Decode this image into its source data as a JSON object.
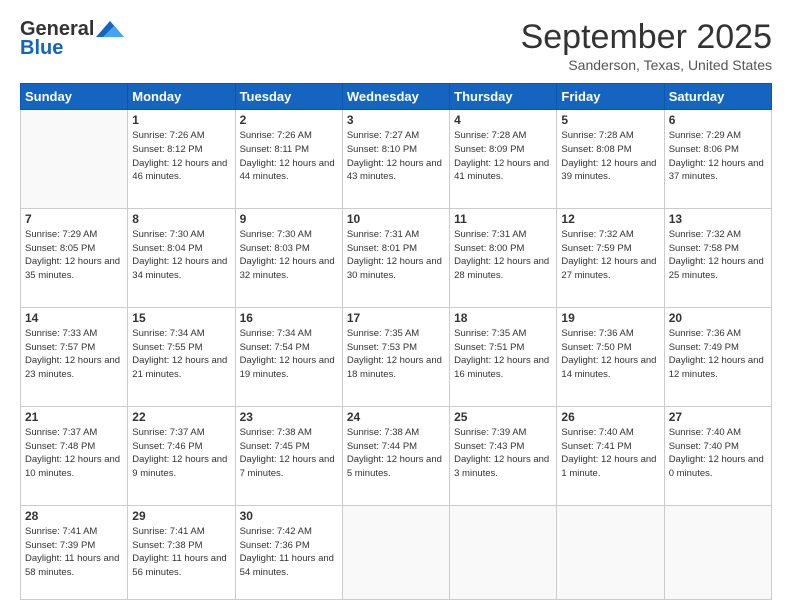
{
  "header": {
    "logo_general": "General",
    "logo_blue": "Blue",
    "month": "September 2025",
    "location": "Sanderson, Texas, United States"
  },
  "days_of_week": [
    "Sunday",
    "Monday",
    "Tuesday",
    "Wednesday",
    "Thursday",
    "Friday",
    "Saturday"
  ],
  "weeks": [
    [
      {
        "day": "",
        "info": ""
      },
      {
        "day": "1",
        "info": "Sunrise: 7:26 AM\nSunset: 8:12 PM\nDaylight: 12 hours\nand 46 minutes."
      },
      {
        "day": "2",
        "info": "Sunrise: 7:26 AM\nSunset: 8:11 PM\nDaylight: 12 hours\nand 44 minutes."
      },
      {
        "day": "3",
        "info": "Sunrise: 7:27 AM\nSunset: 8:10 PM\nDaylight: 12 hours\nand 43 minutes."
      },
      {
        "day": "4",
        "info": "Sunrise: 7:28 AM\nSunset: 8:09 PM\nDaylight: 12 hours\nand 41 minutes."
      },
      {
        "day": "5",
        "info": "Sunrise: 7:28 AM\nSunset: 8:08 PM\nDaylight: 12 hours\nand 39 minutes."
      },
      {
        "day": "6",
        "info": "Sunrise: 7:29 AM\nSunset: 8:06 PM\nDaylight: 12 hours\nand 37 minutes."
      }
    ],
    [
      {
        "day": "7",
        "info": "Sunrise: 7:29 AM\nSunset: 8:05 PM\nDaylight: 12 hours\nand 35 minutes."
      },
      {
        "day": "8",
        "info": "Sunrise: 7:30 AM\nSunset: 8:04 PM\nDaylight: 12 hours\nand 34 minutes."
      },
      {
        "day": "9",
        "info": "Sunrise: 7:30 AM\nSunset: 8:03 PM\nDaylight: 12 hours\nand 32 minutes."
      },
      {
        "day": "10",
        "info": "Sunrise: 7:31 AM\nSunset: 8:01 PM\nDaylight: 12 hours\nand 30 minutes."
      },
      {
        "day": "11",
        "info": "Sunrise: 7:31 AM\nSunset: 8:00 PM\nDaylight: 12 hours\nand 28 minutes."
      },
      {
        "day": "12",
        "info": "Sunrise: 7:32 AM\nSunset: 7:59 PM\nDaylight: 12 hours\nand 27 minutes."
      },
      {
        "day": "13",
        "info": "Sunrise: 7:32 AM\nSunset: 7:58 PM\nDaylight: 12 hours\nand 25 minutes."
      }
    ],
    [
      {
        "day": "14",
        "info": "Sunrise: 7:33 AM\nSunset: 7:57 PM\nDaylight: 12 hours\nand 23 minutes."
      },
      {
        "day": "15",
        "info": "Sunrise: 7:34 AM\nSunset: 7:55 PM\nDaylight: 12 hours\nand 21 minutes."
      },
      {
        "day": "16",
        "info": "Sunrise: 7:34 AM\nSunset: 7:54 PM\nDaylight: 12 hours\nand 19 minutes."
      },
      {
        "day": "17",
        "info": "Sunrise: 7:35 AM\nSunset: 7:53 PM\nDaylight: 12 hours\nand 18 minutes."
      },
      {
        "day": "18",
        "info": "Sunrise: 7:35 AM\nSunset: 7:51 PM\nDaylight: 12 hours\nand 16 minutes."
      },
      {
        "day": "19",
        "info": "Sunrise: 7:36 AM\nSunset: 7:50 PM\nDaylight: 12 hours\nand 14 minutes."
      },
      {
        "day": "20",
        "info": "Sunrise: 7:36 AM\nSunset: 7:49 PM\nDaylight: 12 hours\nand 12 minutes."
      }
    ],
    [
      {
        "day": "21",
        "info": "Sunrise: 7:37 AM\nSunset: 7:48 PM\nDaylight: 12 hours\nand 10 minutes."
      },
      {
        "day": "22",
        "info": "Sunrise: 7:37 AM\nSunset: 7:46 PM\nDaylight: 12 hours\nand 9 minutes."
      },
      {
        "day": "23",
        "info": "Sunrise: 7:38 AM\nSunset: 7:45 PM\nDaylight: 12 hours\nand 7 minutes."
      },
      {
        "day": "24",
        "info": "Sunrise: 7:38 AM\nSunset: 7:44 PM\nDaylight: 12 hours\nand 5 minutes."
      },
      {
        "day": "25",
        "info": "Sunrise: 7:39 AM\nSunset: 7:43 PM\nDaylight: 12 hours\nand 3 minutes."
      },
      {
        "day": "26",
        "info": "Sunrise: 7:40 AM\nSunset: 7:41 PM\nDaylight: 12 hours\nand 1 minute."
      },
      {
        "day": "27",
        "info": "Sunrise: 7:40 AM\nSunset: 7:40 PM\nDaylight: 12 hours\nand 0 minutes."
      }
    ],
    [
      {
        "day": "28",
        "info": "Sunrise: 7:41 AM\nSunset: 7:39 PM\nDaylight: 11 hours\nand 58 minutes."
      },
      {
        "day": "29",
        "info": "Sunrise: 7:41 AM\nSunset: 7:38 PM\nDaylight: 11 hours\nand 56 minutes."
      },
      {
        "day": "30",
        "info": "Sunrise: 7:42 AM\nSunset: 7:36 PM\nDaylight: 11 hours\nand 54 minutes."
      },
      {
        "day": "",
        "info": ""
      },
      {
        "day": "",
        "info": ""
      },
      {
        "day": "",
        "info": ""
      },
      {
        "day": "",
        "info": ""
      }
    ]
  ]
}
